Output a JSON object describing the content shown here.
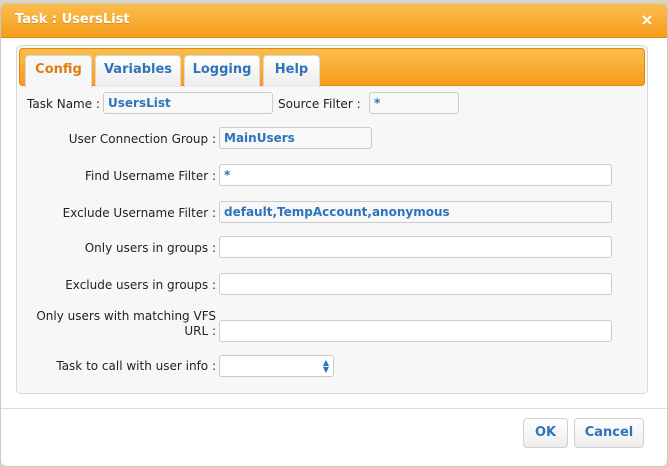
{
  "dialog": {
    "title": "Task : UsersList",
    "close_glyph": "×"
  },
  "tabs": [
    {
      "label": "Config",
      "active": true
    },
    {
      "label": "Variables",
      "active": false
    },
    {
      "label": "Logging",
      "active": false
    },
    {
      "label": "Help",
      "active": false
    }
  ],
  "form": {
    "task_name": {
      "label": "Task Name :",
      "value": "UsersList"
    },
    "source_filter": {
      "label": "Source Filter :",
      "value": "*"
    },
    "user_connection_group": {
      "label": "User Connection Group :",
      "value": "MainUsers"
    },
    "find_username_filter": {
      "label": "Find Username Filter :",
      "value": "*"
    },
    "exclude_username_filter": {
      "label": "Exclude Username Filter :",
      "value": "default,TempAccount,anonymous"
    },
    "only_users_in_groups": {
      "label": "Only users in groups :",
      "value": ""
    },
    "exclude_users_in_groups": {
      "label": "Exclude users in groups :",
      "value": ""
    },
    "only_users_vfs_url": {
      "label_line1": "Only users with matching VFS",
      "label_line2": "URL :",
      "value": ""
    },
    "task_to_call": {
      "label": "Task to call with user info :",
      "selected": ""
    }
  },
  "buttons": {
    "ok": "OK",
    "cancel": "Cancel"
  },
  "colors": {
    "accent_orange": "#f59d1c",
    "link_blue": "#2e74ba",
    "active_tab_text": "#e07d10"
  },
  "icons": {
    "close": "close-icon",
    "select_arrows": "updown-arrows-icon"
  }
}
